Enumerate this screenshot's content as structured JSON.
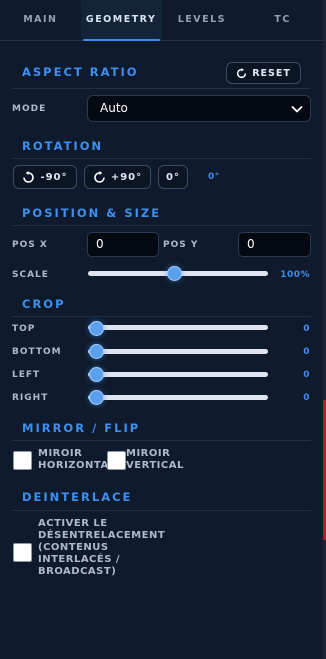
{
  "tabs": [
    {
      "label": "MAIN"
    },
    {
      "label": "GEOMETRY"
    },
    {
      "label": "LEVELS"
    },
    {
      "label": "TC"
    }
  ],
  "active_tab": "GEOMETRY",
  "aspect_ratio": {
    "title": "ASPECT RATIO",
    "reset_label": "RESET",
    "mode_label": "MODE",
    "mode_value": "Auto"
  },
  "rotation": {
    "title": "ROTATION",
    "ccw_label": "-90°",
    "cw_label": "+90°",
    "zero_label": "0°",
    "current": "0°"
  },
  "position_size": {
    "title": "POSITION & SIZE",
    "pos_x_label": "POS X",
    "pos_x_value": "0",
    "pos_y_label": "POS Y",
    "pos_y_value": "0",
    "scale_label": "SCALE",
    "scale_value": "100%",
    "scale_fraction": 0.48
  },
  "crop": {
    "title": "CROP",
    "items": [
      {
        "label": "TOP",
        "value": "0"
      },
      {
        "label": "BOTTOM",
        "value": "0"
      },
      {
        "label": "LEFT",
        "value": "0"
      },
      {
        "label": "RIGHT",
        "value": "0"
      }
    ]
  },
  "mirror": {
    "title": "MIRROR / FLIP",
    "horizontal_line1": "MIROIR",
    "horizontal_line2": "HORIZONTAL",
    "vertical_line1": "MIROIR",
    "vertical_line2": "VERTICAL"
  },
  "deinterlace": {
    "title": "DEINTERLACE",
    "lines": [
      "ACTIVER LE",
      "DÉSENTRELACEMENT",
      "(CONTENUS",
      "INTERLACÉS /",
      "BROADCAST)"
    ]
  },
  "colors": {
    "background": "#0f1b2c",
    "accent": "#3d8ff0",
    "scrollbar_marker": "#b51d1d"
  }
}
